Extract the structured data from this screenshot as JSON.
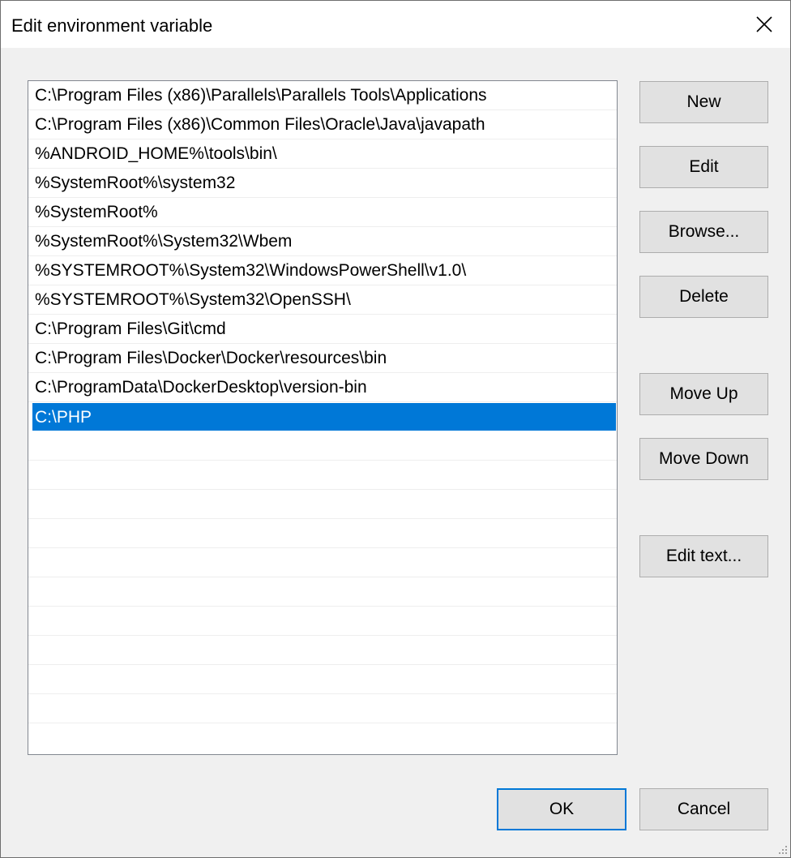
{
  "window": {
    "title": "Edit environment variable"
  },
  "entries": [
    "C:\\Program Files (x86)\\Parallels\\Parallels Tools\\Applications",
    "C:\\Program Files (x86)\\Common Files\\Oracle\\Java\\javapath",
    "%ANDROID_HOME%\\tools\\bin\\",
    "%SystemRoot%\\system32",
    "%SystemRoot%",
    "%SystemRoot%\\System32\\Wbem",
    "%SYSTEMROOT%\\System32\\WindowsPowerShell\\v1.0\\",
    "%SYSTEMROOT%\\System32\\OpenSSH\\",
    "C:\\Program Files\\Git\\cmd",
    "C:\\Program Files\\Docker\\Docker\\resources\\bin",
    "C:\\ProgramData\\DockerDesktop\\version-bin",
    "C:\\PHP"
  ],
  "selected_entry": "C:\\PHP",
  "buttons": {
    "new": "New",
    "edit": "Edit",
    "browse": "Browse...",
    "delete": "Delete",
    "move_up": "Move Up",
    "move_down": "Move Down",
    "edit_text": "Edit text...",
    "ok": "OK",
    "cancel": "Cancel"
  },
  "icons": {
    "close": "close-icon",
    "resize": "resize-grip-icon"
  },
  "colors": {
    "selection": "#0078d7",
    "default_button_border": "#0078d7"
  }
}
